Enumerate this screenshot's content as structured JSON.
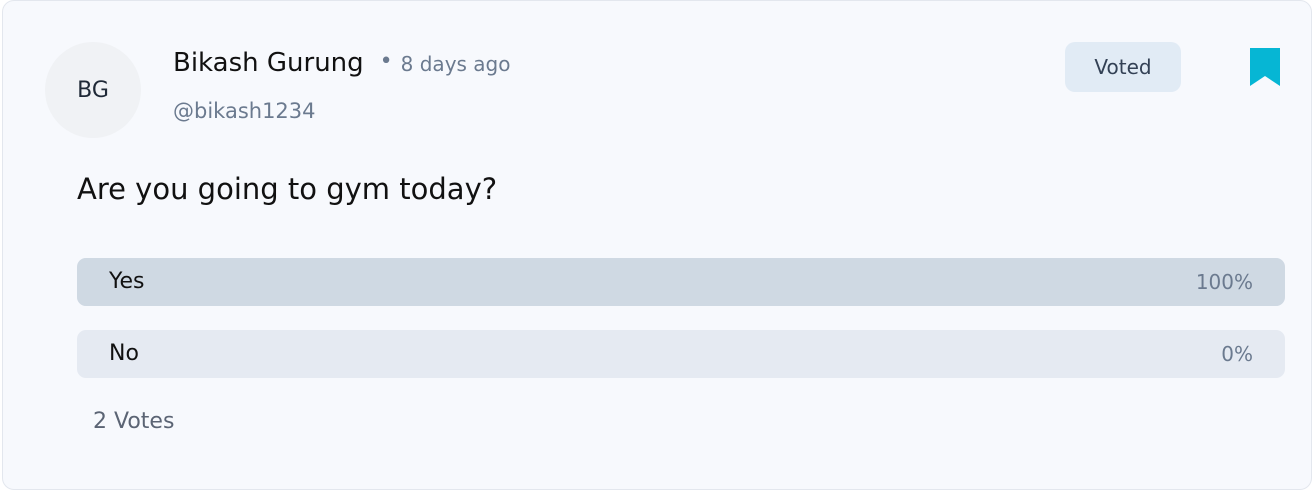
{
  "post": {
    "avatar_initials": "BG",
    "author_name": "Bikash Gurung",
    "separator": "•",
    "time_ago": "8 days ago",
    "handle": "@bikash1234",
    "status_badge": "Voted",
    "question": "Are you going to gym today?",
    "options": [
      {
        "label": "Yes",
        "percent_label": "100%",
        "percent": 100
      },
      {
        "label": "No",
        "percent_label": "0%",
        "percent": 0
      }
    ],
    "votes_label": "2 Votes"
  },
  "colors": {
    "bookmark": "#06b6d4",
    "option_fill": "#cfd9e3",
    "option_track": "#e5eaf2",
    "badge_bg": "#e1ebf5"
  },
  "icons": {
    "bookmark": "bookmark-icon"
  }
}
